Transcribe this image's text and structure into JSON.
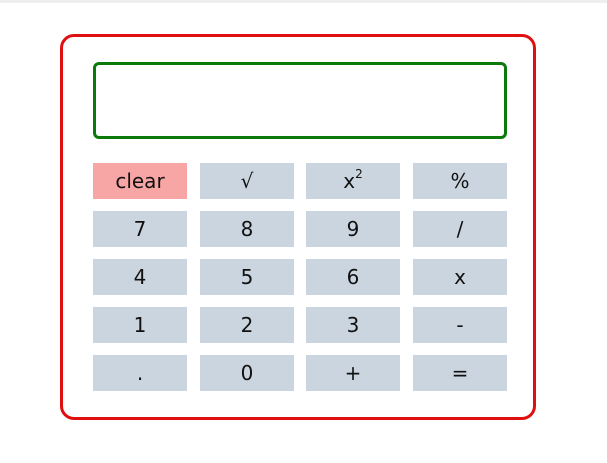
{
  "display": {
    "value": ""
  },
  "keys": {
    "row1": [
      "clear",
      "√",
      "x",
      "%"
    ],
    "square_superscript": "2",
    "row2": [
      "7",
      "8",
      "9",
      "/"
    ],
    "row3": [
      "4",
      "5",
      "6",
      "x"
    ],
    "row4": [
      "1",
      "2",
      "3",
      "-"
    ],
    "row5": [
      ".",
      "0",
      "+",
      "="
    ]
  },
  "colors": {
    "frame_border": "#e01010",
    "display_border": "#0b7a0b",
    "key_background": "#cbd5e0",
    "clear_background": "#f8a5a5"
  }
}
